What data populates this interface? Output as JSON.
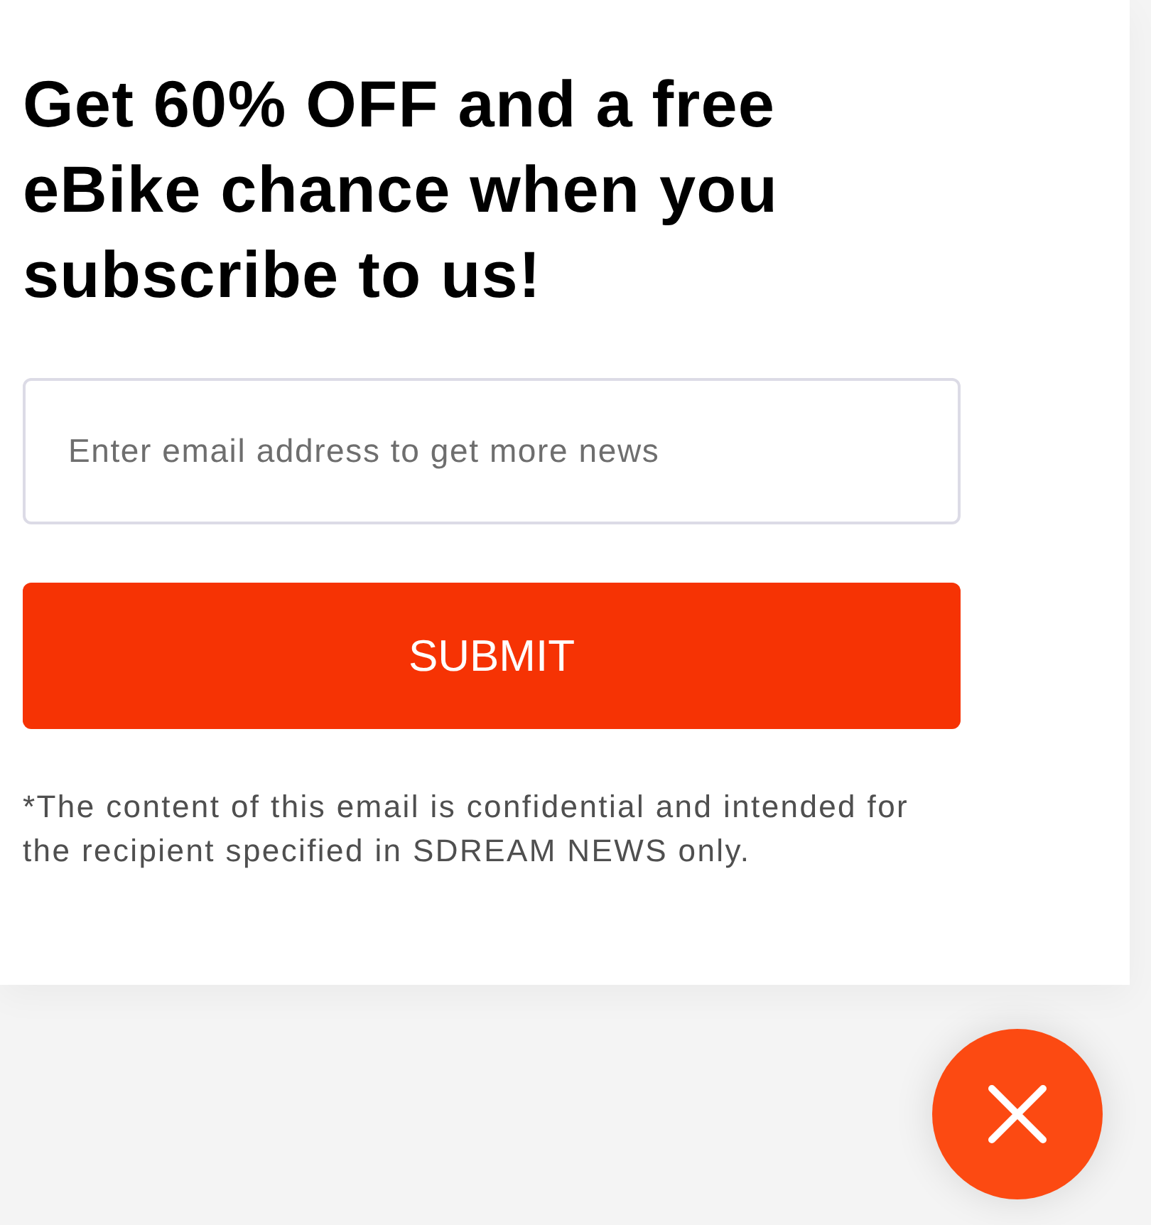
{
  "heading": "Get 60% OFF and a free eBike chance when you subscribe to us!",
  "email_field": {
    "placeholder": "Enter email address to get more news"
  },
  "submit_button": {
    "label": "SUBMIT"
  },
  "disclaimer": "*The content of this email is confidential and intended for the recipient specified in SDREAM NEWS only."
}
